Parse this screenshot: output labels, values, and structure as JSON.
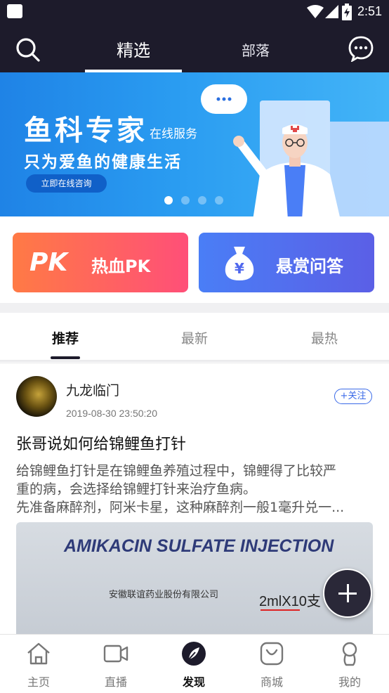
{
  "status_bar": {
    "time": "2:51"
  },
  "top_nav": {
    "tabs": [
      {
        "label": "精选",
        "active": true
      },
      {
        "label": "部落",
        "active": false
      }
    ]
  },
  "banner": {
    "title": "鱼科专家",
    "title_suffix": "在线服务",
    "subtitle": "只为爱鱼的健康生活",
    "button_label": "立即在线咨询",
    "page_count": 4,
    "active_page": 1
  },
  "features": [
    {
      "label": "热血PK",
      "logo": "PK",
      "icon": "pk-logo-icon"
    },
    {
      "label": "悬赏问答",
      "icon": "money-bag-icon"
    }
  ],
  "sub_tabs": [
    {
      "label": "推荐",
      "active": true
    },
    {
      "label": "最新",
      "active": false
    },
    {
      "label": "最热",
      "active": false
    }
  ],
  "post": {
    "author": "九龙临门",
    "time": "2019-08-30 23:50:20",
    "follow_label": "+关注",
    "title": "张哥说如何给锦鲤鱼打针",
    "excerpt_lines": [
      "给锦鲤鱼打针是在锦鲤鱼养殖过程中，锦鲤得了比较严",
      "重的病，会选择给锦鲤打针来治疗鱼病。",
      "先准备麻醉剂，阿米卡星，这种麻醉剂一般1毫升兑一..."
    ],
    "image_text": {
      "heading": "AMIKACIN SULFATE INJECTION",
      "company": "安徽联谊药业股份有限公司",
      "dose": "2mlX10支"
    }
  },
  "bottom_tabs": [
    {
      "label": "主页",
      "icon": "home-icon",
      "active": false
    },
    {
      "label": "直播",
      "icon": "video-camera-icon",
      "active": false
    },
    {
      "label": "发现",
      "icon": "compass-icon",
      "active": true
    },
    {
      "label": "商城",
      "icon": "shopping-bag-icon",
      "active": false
    },
    {
      "label": "我的",
      "icon": "profile-icon",
      "active": false
    }
  ],
  "colors": {
    "header_bg": "#1d1b2b",
    "banner_blue": "#2a9cf1",
    "pk_gradient_start": "#ff7a45",
    "pk_gradient_end": "#ff4f78",
    "qa_gradient_start": "#4a7ef6",
    "qa_gradient_end": "#5b5fe6",
    "follow_blue": "#3a6ae8"
  }
}
